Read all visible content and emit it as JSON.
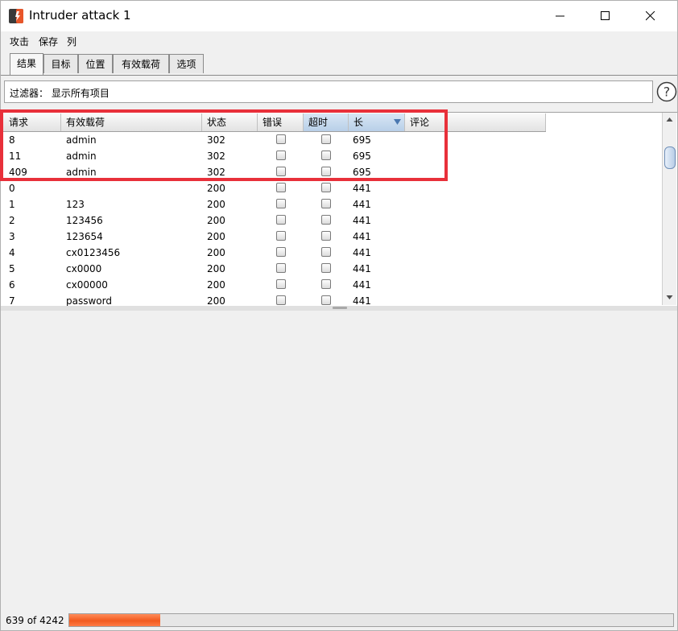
{
  "window": {
    "title": "Intruder attack 1"
  },
  "menu": [
    "攻击",
    "保存",
    "列"
  ],
  "tabs": [
    {
      "label": "结果",
      "active": true
    },
    {
      "label": "目标",
      "active": false
    },
    {
      "label": "位置",
      "active": false
    },
    {
      "label": "有效载荷",
      "active": false
    },
    {
      "label": "选项",
      "active": false
    }
  ],
  "filter": {
    "text": "过滤器：  显示所有项目"
  },
  "table": {
    "columns": [
      "请求",
      "有效载荷",
      "状态",
      "错误",
      "超时",
      "长",
      "评论"
    ],
    "sorted_column": "长",
    "rows": [
      {
        "req": "8",
        "payload": "admin",
        "status": "302",
        "error": false,
        "timeout": false,
        "length": "695",
        "comment": ""
      },
      {
        "req": "11",
        "payload": "admin",
        "status": "302",
        "error": false,
        "timeout": false,
        "length": "695",
        "comment": ""
      },
      {
        "req": "409",
        "payload": "admin",
        "status": "302",
        "error": false,
        "timeout": false,
        "length": "695",
        "comment": ""
      },
      {
        "req": "0",
        "payload": "",
        "status": "200",
        "error": false,
        "timeout": false,
        "length": "441",
        "comment": ""
      },
      {
        "req": "1",
        "payload": "123",
        "status": "200",
        "error": false,
        "timeout": false,
        "length": "441",
        "comment": ""
      },
      {
        "req": "2",
        "payload": "123456",
        "status": "200",
        "error": false,
        "timeout": false,
        "length": "441",
        "comment": ""
      },
      {
        "req": "3",
        "payload": "123654",
        "status": "200",
        "error": false,
        "timeout": false,
        "length": "441",
        "comment": ""
      },
      {
        "req": "4",
        "payload": "cx0123456",
        "status": "200",
        "error": false,
        "timeout": false,
        "length": "441",
        "comment": ""
      },
      {
        "req": "5",
        "payload": "cx0000",
        "status": "200",
        "error": false,
        "timeout": false,
        "length": "441",
        "comment": ""
      },
      {
        "req": "6",
        "payload": "cx00000",
        "status": "200",
        "error": false,
        "timeout": false,
        "length": "441",
        "comment": ""
      },
      {
        "req": "7",
        "payload": "password",
        "status": "200",
        "error": false,
        "timeout": false,
        "length": "441",
        "comment": ""
      }
    ]
  },
  "status": {
    "progress_text": "639 of 4242",
    "progress_fraction": 0.1506
  },
  "colors": {
    "highlight": "#e8303a",
    "progress": "#f25a1e",
    "app_icon": "#e8562a"
  },
  "icons": [
    "burp-app-icon",
    "minimize-icon",
    "maximize-icon",
    "close-icon",
    "help-icon",
    "sort-desc-icon",
    "scroll-up-icon",
    "scroll-down-icon"
  ]
}
